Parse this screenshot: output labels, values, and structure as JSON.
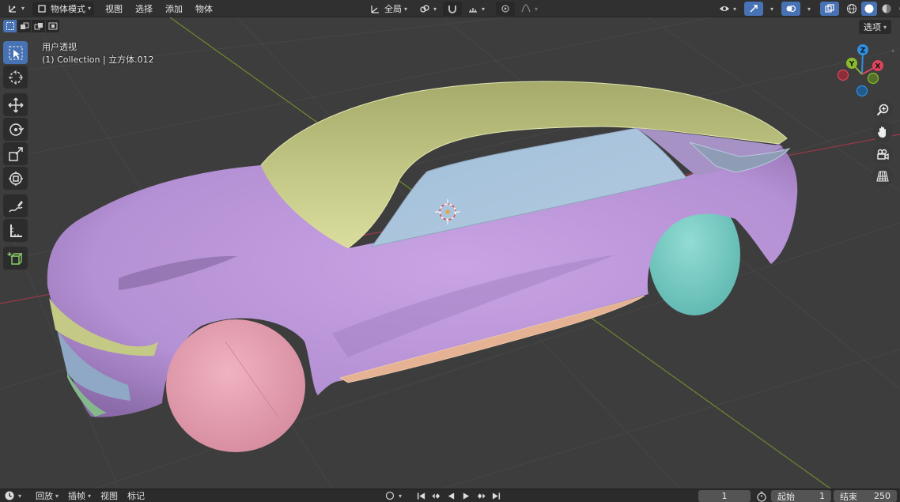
{
  "header": {
    "mode_label": "物体模式",
    "menus": [
      "视图",
      "选择",
      "添加",
      "物体"
    ],
    "transform_orientation": "全局"
  },
  "viewport": {
    "view_label": "用户透视",
    "collection_label": "(1) Collection | 立方体.012",
    "options_label": "选项",
    "gizmo_axes": [
      "X",
      "Y",
      "Z"
    ]
  },
  "colors": {
    "accent": "#4772b3",
    "body_purple": "#b994d6",
    "roof_yellow": "#c4c882",
    "glass_blue": "#a9c4dc",
    "wheel_pink": "#e8a0b0",
    "wheel_cyan": "#7fd0c8",
    "skirt_orange": "#e5b393",
    "axis_x": "#e0445c",
    "axis_y": "#8bba2e",
    "axis_z": "#2e8fe0"
  },
  "tools": [
    "select-box-icon",
    "cursor-icon",
    "move-icon",
    "rotate-icon",
    "scale-icon",
    "transform-icon",
    "annotate-icon",
    "measure-icon",
    "add-cube-icon"
  ],
  "timeline": {
    "menus": [
      "回放",
      "插帧",
      "视图",
      "标记"
    ],
    "current_frame": "1",
    "start_label": "起始",
    "start_value": "1",
    "end_label": "结束",
    "end_value": "250"
  }
}
